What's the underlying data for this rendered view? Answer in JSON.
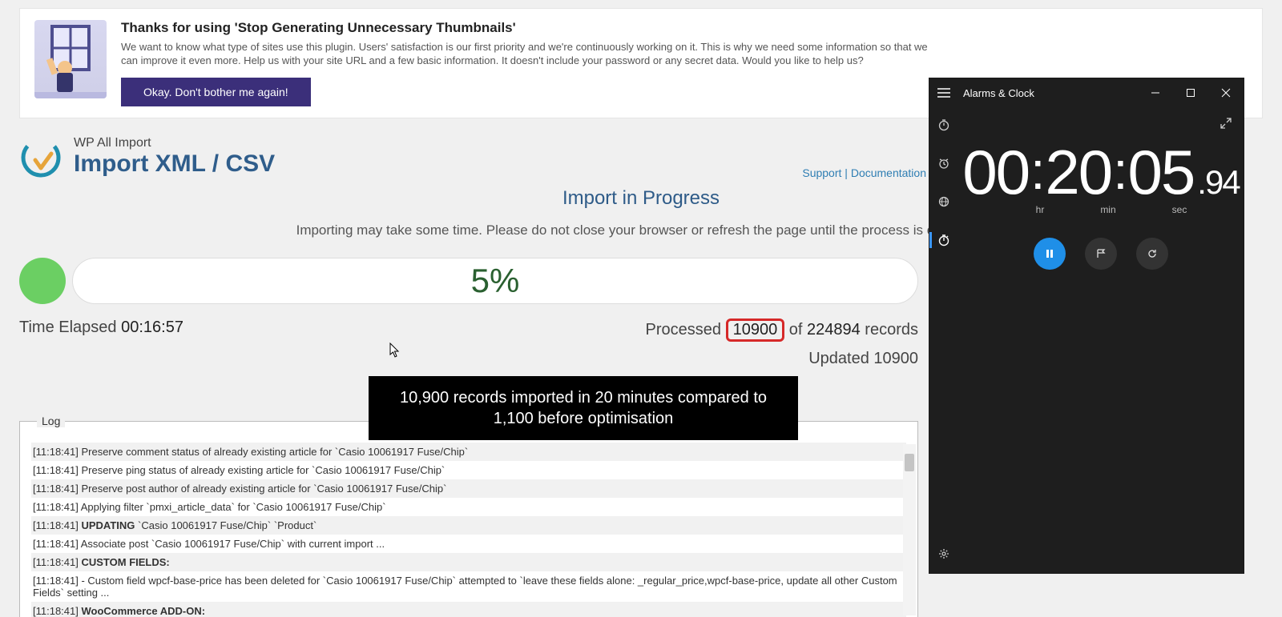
{
  "notice": {
    "title": "Thanks for using 'Stop Generating Unnecessary Thumbnails'",
    "body": "We want to know what type of sites use this plugin. Users' satisfaction is our first priority and we're continuously working on it. This is why we need some information so that we can improve it even more. Help us with your site URL and a few basic information. It doesn't include your password or any secret data. Would you like to help us?",
    "button": "Okay. Don't bother me again!"
  },
  "page": {
    "breadcrumb": "WP All Import",
    "title": "Import XML / CSV",
    "links": {
      "support": "Support",
      "sep": " | ",
      "docs": "Documentation"
    },
    "progress_title": "Import in Progress",
    "progress_sub": "Importing may take some time. Please do not close your browser or refresh the page until the process is complete.",
    "percent": "5%",
    "elapsed_label": "Time Elapsed ",
    "elapsed_value": "00:16:57",
    "processed_label": "Processed ",
    "processed_value": "10900",
    "processed_of": " of ",
    "processed_total": "224894",
    "processed_suffix": " records",
    "updated_label": "Updated ",
    "updated_value": "10900"
  },
  "callout": "10,900 records imported in 20 minutes compared to 1,100 before optimisation",
  "log": {
    "legend": "Log",
    "entries": [
      "[11:18:41] Preserve comment status of already existing article for `Casio 10061917 Fuse/Chip`",
      "[11:18:41] Preserve ping status of already existing article for `Casio 10061917 Fuse/Chip`",
      "[11:18:41] Preserve post author of already existing article for `Casio 10061917 Fuse/Chip`",
      "[11:18:41] Applying filter `pmxi_article_data` for `Casio 10061917 Fuse/Chip`",
      "[11:18:41] UPDATING `Casio 10061917 Fuse/Chip` `Product`",
      "[11:18:41] Associate post `Casio 10061917 Fuse/Chip` with current import ...",
      "[11:18:41] CUSTOM FIELDS:",
      "[11:18:41] - Custom field wpcf-base-price has been deleted for `Casio 10061917 Fuse/Chip` attempted to `leave these fields alone: _regular_price,wpcf-base-price, update all other Custom Fields` setting ...",
      "[11:18:41] WooCommerce ADD-ON:"
    ]
  },
  "clockwin": {
    "title": "Alarms & Clock",
    "time": {
      "hr": "00",
      "min": "20",
      "sec": "05",
      "frac": "94"
    },
    "labels": {
      "hr": "hr",
      "min": "min",
      "sec": "sec"
    }
  }
}
